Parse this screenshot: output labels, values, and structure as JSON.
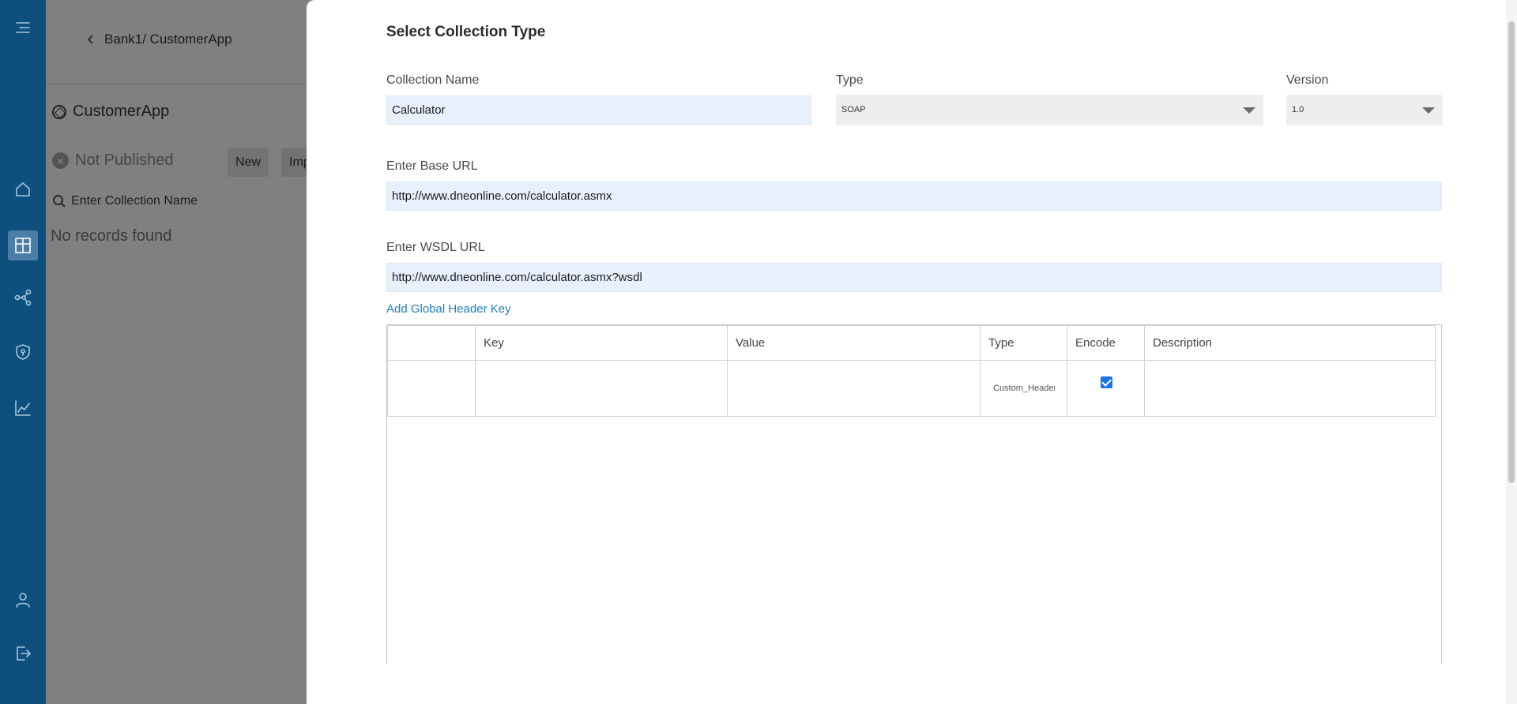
{
  "nav": {
    "items": [
      "menu-icon",
      "home-icon",
      "dashboard-icon",
      "share-icon",
      "shield-icon",
      "chart-icon",
      "user-icon",
      "logout-icon"
    ]
  },
  "background": {
    "breadcrumb": "Bank1/ CustomerApp",
    "app_name": "CustomerApp",
    "status": "Not Published",
    "new_button": "New",
    "import_button": "Imp",
    "search_placeholder": "Enter Collection Name",
    "empty_text": "No records found"
  },
  "modal": {
    "title": "Select Collection Type",
    "collection_name_label": "Collection Name",
    "collection_name_value": "Calculator",
    "type_label": "Type",
    "type_value": "SOAP",
    "version_label": "Version",
    "version_value": "1.0",
    "base_url_label": "Enter Base URL",
    "base_url_value": "http://www.dneonline.com/calculator.asmx",
    "wsdl_url_label": "Enter WSDL URL",
    "wsdl_url_value": "http://www.dneonline.com/calculator.asmx?wsdl",
    "add_header_link": "Add Global Header Key",
    "table": {
      "columns": [
        "",
        "Key",
        "Value",
        "Type",
        "Encode",
        "Description"
      ],
      "rows": [
        {
          "key": "",
          "value": "",
          "type": "Custom_Header",
          "encode": true,
          "description": ""
        }
      ]
    }
  }
}
